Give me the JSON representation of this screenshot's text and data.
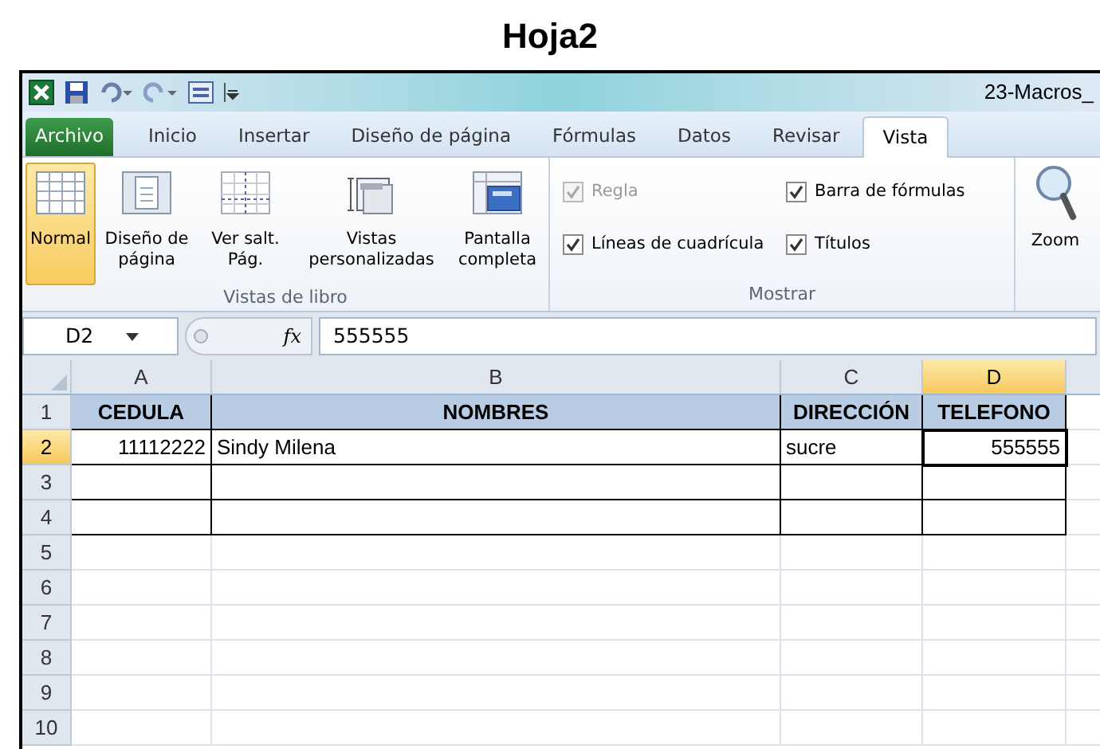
{
  "page_title": "Hoja2",
  "window": {
    "title": "23-Macros_"
  },
  "tabs": [
    {
      "label": "Archivo",
      "kind": "file",
      "selected": false
    },
    {
      "label": "Inicio",
      "kind": "tab",
      "selected": false
    },
    {
      "label": "Insertar",
      "kind": "tab",
      "selected": false
    },
    {
      "label": "Diseño de página",
      "kind": "tab",
      "selected": false
    },
    {
      "label": "Fórmulas",
      "kind": "tab",
      "selected": false
    },
    {
      "label": "Datos",
      "kind": "tab",
      "selected": false
    },
    {
      "label": "Revisar",
      "kind": "tab",
      "selected": false
    },
    {
      "label": "Vista",
      "kind": "tab",
      "selected": true
    }
  ],
  "view_group": {
    "label": "Vistas de libro",
    "buttons": [
      {
        "label": "Normal",
        "selected": true
      },
      {
        "label": "Diseño de página",
        "selected": false
      },
      {
        "label": "Ver salt. Pág.",
        "selected": false
      },
      {
        "label": "Vistas personalizadas",
        "selected": false
      },
      {
        "label": "Pantalla completa",
        "selected": false
      }
    ]
  },
  "show_group": {
    "label": "Mostrar",
    "checkboxes": [
      {
        "label": "Regla",
        "checked": true,
        "disabled": true
      },
      {
        "label": "Barra de fórmulas",
        "checked": true,
        "disabled": false
      },
      {
        "label": "Líneas de cuadrícula",
        "checked": true,
        "disabled": false
      },
      {
        "label": "Títulos",
        "checked": true,
        "disabled": false
      }
    ]
  },
  "zoom_button": {
    "label": "Zoom"
  },
  "formula_bar": {
    "name_box": "D2",
    "fx": "fx",
    "value": "555555"
  },
  "columns": [
    {
      "label": "A",
      "selected": false
    },
    {
      "label": "B",
      "selected": false
    },
    {
      "label": "C",
      "selected": false
    },
    {
      "label": "D",
      "selected": true
    }
  ],
  "rows": [
    {
      "number": "1",
      "kind": "header",
      "selected": false,
      "cells": [
        {
          "text": "CEDULA",
          "active": false
        },
        {
          "text": "NOMBRES",
          "active": false
        },
        {
          "text": "DIRECCIÓN",
          "active": false
        },
        {
          "text": "TELEFONO",
          "active": false
        }
      ]
    },
    {
      "number": "2",
      "kind": "data",
      "selected": true,
      "cells": [
        {
          "text": "11112222",
          "active": false
        },
        {
          "text": "Sindy Milena",
          "active": false
        },
        {
          "text": "sucre",
          "active": false
        },
        {
          "text": "555555",
          "active": true
        }
      ]
    },
    {
      "number": "3",
      "kind": "data",
      "selected": false
    },
    {
      "number": "4",
      "kind": "data",
      "selected": false
    },
    {
      "number": "5",
      "kind": "blank",
      "selected": false
    },
    {
      "number": "6",
      "kind": "blank",
      "selected": false
    },
    {
      "number": "7",
      "kind": "blank",
      "selected": false
    },
    {
      "number": "8",
      "kind": "blank",
      "selected": false
    },
    {
      "number": "9",
      "kind": "blank",
      "selected": false
    },
    {
      "number": "10",
      "kind": "blank",
      "selected": false
    }
  ]
}
